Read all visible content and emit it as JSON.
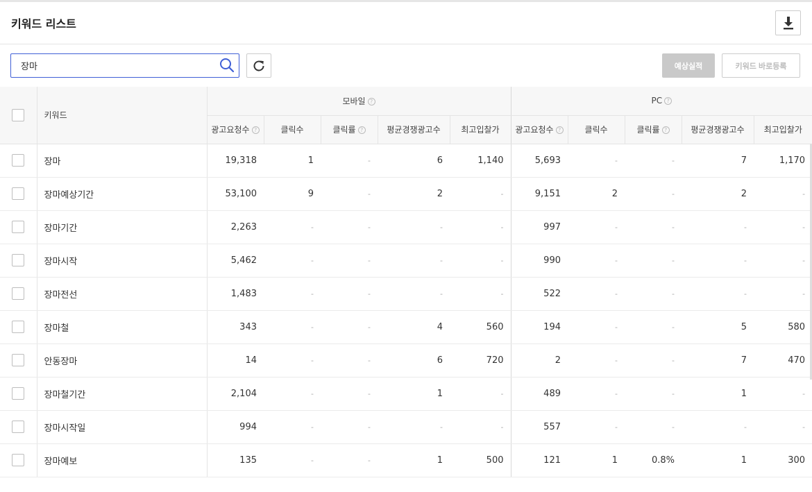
{
  "header": {
    "title": "키워드 리스트",
    "download_icon": "download-icon"
  },
  "search": {
    "value": "장마",
    "search_icon": "search-icon",
    "refresh_icon": "refresh-icon"
  },
  "buttons": {
    "estimate": "예상실적",
    "register": "키워드 바로등록"
  },
  "table": {
    "col_keyword": "키워드",
    "group_mobile": "모바일",
    "group_pc": "PC",
    "subcols": [
      "광고요청수",
      "클릭수",
      "클릭률",
      "평균경쟁광고수",
      "최고입찰가"
    ],
    "rows": [
      {
        "keyword": "장마",
        "mobile": [
          "19,318",
          "1",
          "-",
          "6",
          "1,140"
        ],
        "pc": [
          "5,693",
          "-",
          "-",
          "7",
          "1,170"
        ]
      },
      {
        "keyword": "장마예상기간",
        "mobile": [
          "53,100",
          "9",
          "-",
          "2",
          "-"
        ],
        "pc": [
          "9,151",
          "2",
          "-",
          "2",
          "-"
        ]
      },
      {
        "keyword": "장마기간",
        "mobile": [
          "2,263",
          "-",
          "-",
          "-",
          "-"
        ],
        "pc": [
          "997",
          "-",
          "-",
          "-",
          "-"
        ]
      },
      {
        "keyword": "장마시작",
        "mobile": [
          "5,462",
          "-",
          "-",
          "-",
          "-"
        ],
        "pc": [
          "990",
          "-",
          "-",
          "-",
          "-"
        ]
      },
      {
        "keyword": "장마전선",
        "mobile": [
          "1,483",
          "-",
          "-",
          "-",
          "-"
        ],
        "pc": [
          "522",
          "-",
          "-",
          "-",
          "-"
        ]
      },
      {
        "keyword": "장마철",
        "mobile": [
          "343",
          "-",
          "-",
          "4",
          "560"
        ],
        "pc": [
          "194",
          "-",
          "-",
          "5",
          "580"
        ]
      },
      {
        "keyword": "안동장마",
        "mobile": [
          "14",
          "-",
          "-",
          "6",
          "720"
        ],
        "pc": [
          "2",
          "-",
          "-",
          "7",
          "470"
        ]
      },
      {
        "keyword": "장마철기간",
        "mobile": [
          "2,104",
          "-",
          "-",
          "1",
          "-"
        ],
        "pc": [
          "489",
          "-",
          "-",
          "1",
          "-"
        ]
      },
      {
        "keyword": "장마시작일",
        "mobile": [
          "994",
          "-",
          "-",
          "-",
          "-"
        ],
        "pc": [
          "557",
          "-",
          "-",
          "-",
          "-"
        ]
      },
      {
        "keyword": "장마예보",
        "mobile": [
          "135",
          "-",
          "-",
          "1",
          "500"
        ],
        "pc": [
          "121",
          "1",
          "0.8%",
          "1",
          "300"
        ]
      }
    ]
  }
}
